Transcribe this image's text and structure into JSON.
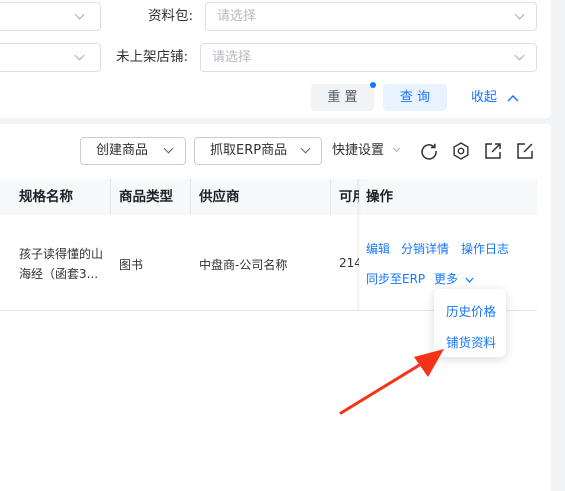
{
  "filters": {
    "package_label": "资料包:",
    "package_placeholder": "请选择",
    "unlisted_store_label": "未上架店铺:",
    "unlisted_store_placeholder": "请选择"
  },
  "actions": {
    "reset": "重 置",
    "query": "查 询",
    "collapse": "收起"
  },
  "toolbar": {
    "create_product": "创建商品",
    "fetch_erp": "抓取ERP商品",
    "quick_settings": "快捷设置"
  },
  "table": {
    "headers": [
      "规格名称",
      "商品类型",
      "供应商",
      "可用",
      "操作"
    ],
    "rows": [
      {
        "name_line1": "孩子读得懂的山",
        "name_line2": "海经（函套3...",
        "type": "图书",
        "supplier": "中盘商-公司名称",
        "available": "214",
        "ops": [
          "编辑",
          "分销详情",
          "操作日志",
          "同步至ERP",
          "更多"
        ]
      }
    ]
  },
  "dropdown": {
    "items": [
      "历史价格",
      "铺货资料"
    ]
  },
  "colors": {
    "accent": "#1677ff",
    "query_bg": "#e8f3ff",
    "badge": "#1677ff",
    "arrow": "#f5331a"
  }
}
